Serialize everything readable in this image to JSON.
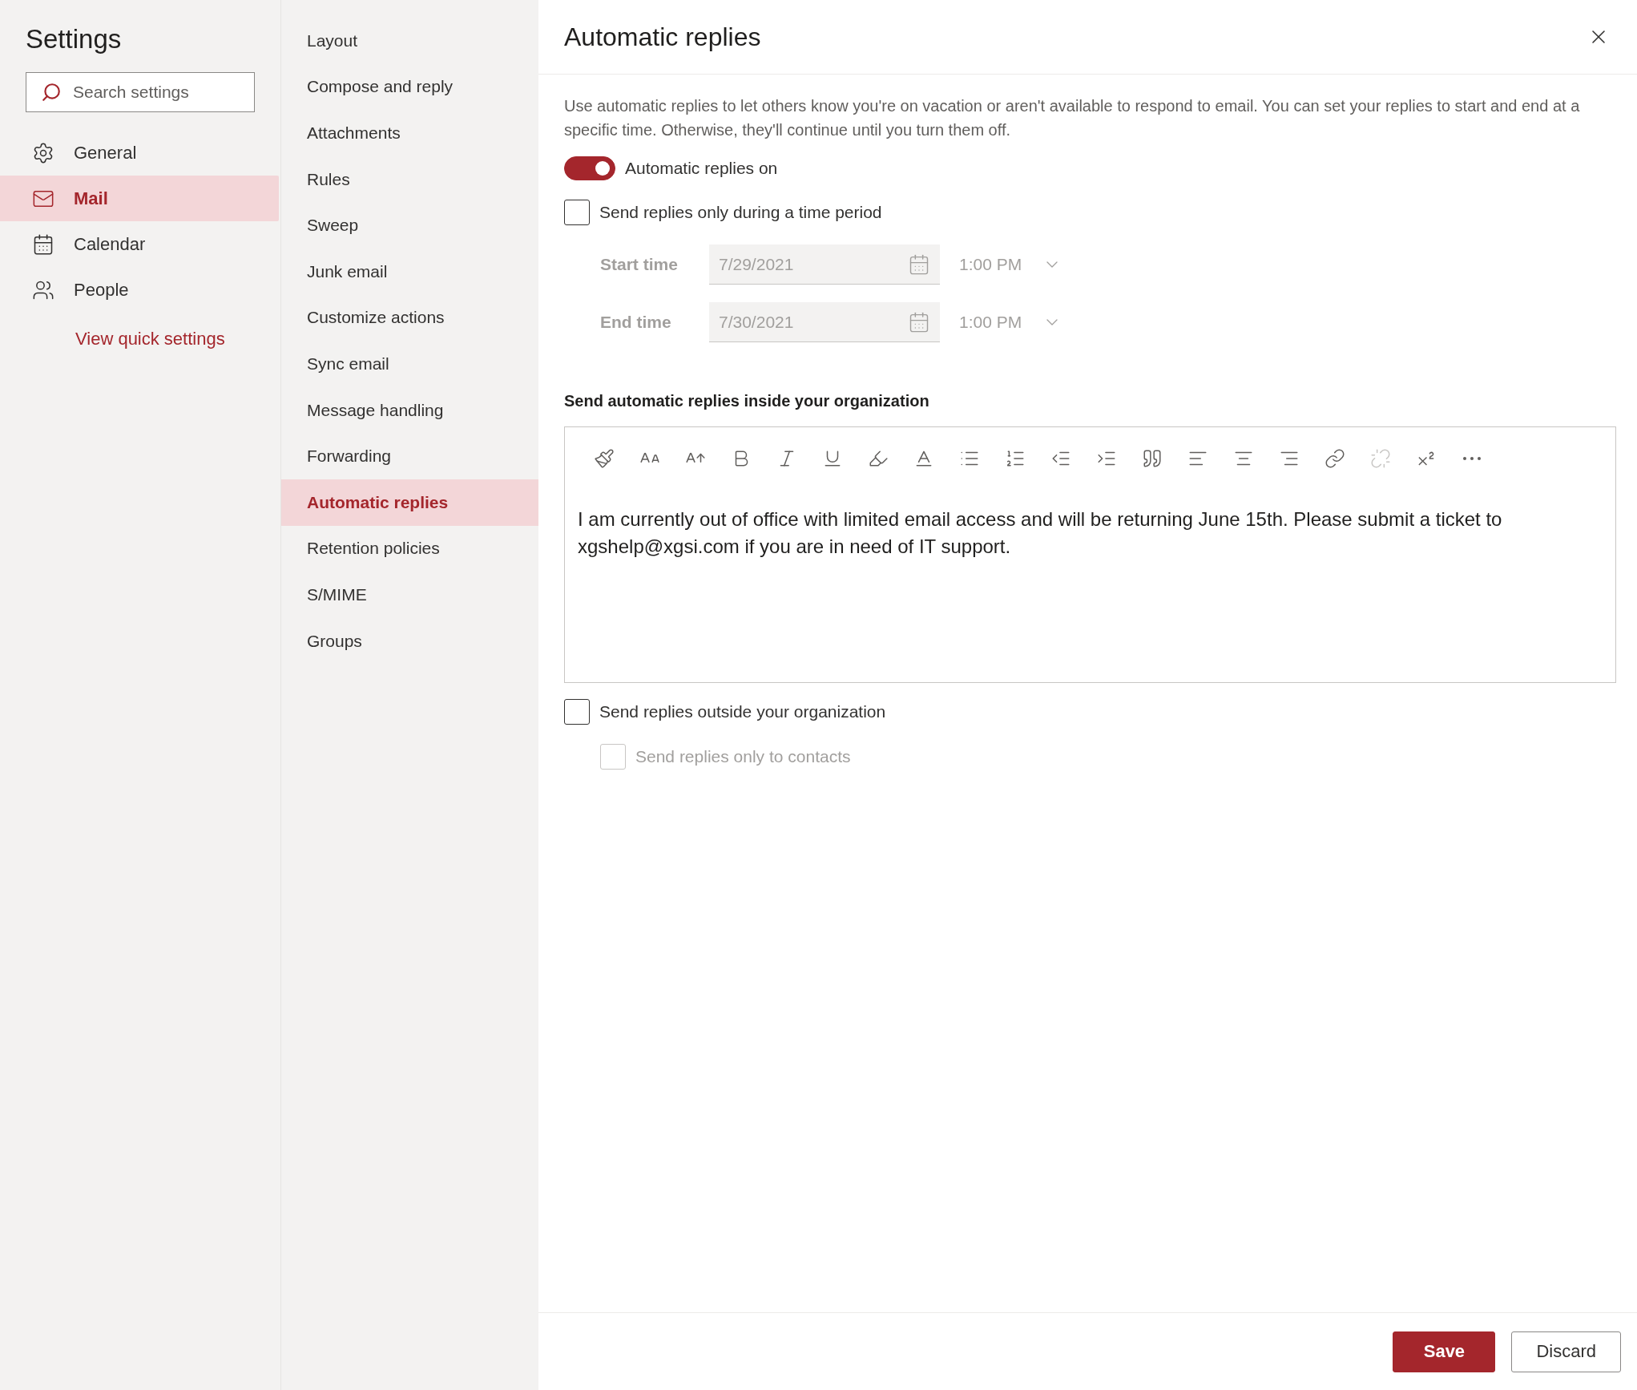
{
  "sidebar": {
    "title": "Settings",
    "search": {
      "placeholder": "Search settings"
    },
    "items": [
      {
        "label": "General",
        "selected": false
      },
      {
        "label": "Mail",
        "selected": true
      },
      {
        "label": "Calendar",
        "selected": false
      },
      {
        "label": "People",
        "selected": false
      }
    ],
    "link": "View quick settings"
  },
  "subnav": {
    "items": [
      {
        "label": "Layout",
        "selected": false
      },
      {
        "label": "Compose and reply",
        "selected": false
      },
      {
        "label": "Attachments",
        "selected": false
      },
      {
        "label": "Rules",
        "selected": false
      },
      {
        "label": "Sweep",
        "selected": false
      },
      {
        "label": "Junk email",
        "selected": false
      },
      {
        "label": "Customize actions",
        "selected": false
      },
      {
        "label": "Sync email",
        "selected": false
      },
      {
        "label": "Message handling",
        "selected": false
      },
      {
        "label": "Forwarding",
        "selected": false
      },
      {
        "label": "Automatic replies",
        "selected": true
      },
      {
        "label": "Retention policies",
        "selected": false
      },
      {
        "label": "S/MIME",
        "selected": false
      },
      {
        "label": "Groups",
        "selected": false
      }
    ]
  },
  "panel": {
    "title": "Automatic replies",
    "description": "Use automatic replies to let others know you're on vacation or aren't available to respond to email. You can set your replies to start and end at a specific time. Otherwise, they'll continue until you turn them off.",
    "toggle": {
      "label": "Automatic replies on",
      "on": true
    },
    "time_period": {
      "label": "Send replies only during a time period",
      "checked": false
    },
    "times": [
      {
        "label": "Start time",
        "date": "7/29/2021",
        "time": "1:00 PM",
        "disabled": true
      },
      {
        "label": "End time",
        "date": "7/30/2021",
        "time": "1:00 PM",
        "disabled": true
      }
    ],
    "inside_heading": "Send automatic replies inside your organization",
    "toolbar": [
      {
        "kind": "format-painter",
        "disabled": false
      },
      {
        "kind": "font-size",
        "disabled": false
      },
      {
        "kind": "grow-font",
        "disabled": false
      },
      {
        "kind": "bold",
        "disabled": false
      },
      {
        "kind": "italic",
        "disabled": false
      },
      {
        "kind": "underline",
        "disabled": false
      },
      {
        "kind": "highlight",
        "disabled": false
      },
      {
        "kind": "font-color",
        "disabled": false
      },
      {
        "kind": "bullets",
        "disabled": false
      },
      {
        "kind": "numbering",
        "disabled": false
      },
      {
        "kind": "outdent",
        "disabled": false
      },
      {
        "kind": "indent",
        "disabled": false
      },
      {
        "kind": "quote",
        "disabled": false
      },
      {
        "kind": "align-left",
        "disabled": false
      },
      {
        "kind": "align-center",
        "disabled": false
      },
      {
        "kind": "align-right",
        "disabled": false
      },
      {
        "kind": "link",
        "disabled": false
      },
      {
        "kind": "unlink",
        "disabled": true
      },
      {
        "kind": "superscript",
        "disabled": false
      },
      {
        "kind": "more",
        "disabled": false
      }
    ],
    "message": "I am currently out of office with limited email access and will be returning June 15th. Please submit a ticket to xgshelp@xgsi.com if you are in need of IT support.",
    "outside": {
      "label": "Send replies outside your organization",
      "checked": false
    },
    "contacts_only": {
      "label": "Send replies only to contacts",
      "checked": false,
      "disabled": true
    },
    "buttons": [
      {
        "label": "Save",
        "kind": "primary"
      },
      {
        "label": "Discard",
        "kind": "secondary"
      }
    ]
  }
}
